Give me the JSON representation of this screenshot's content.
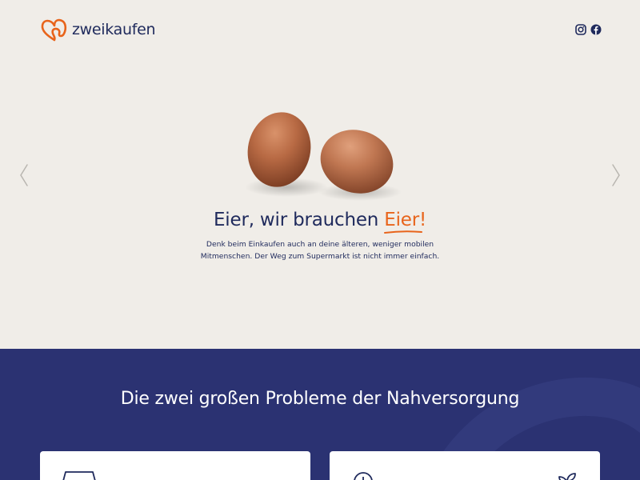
{
  "header": {
    "brand": "zweikaufen",
    "social": [
      "instagram-icon",
      "facebook-icon"
    ]
  },
  "hero": {
    "headline_prefix": "Eier, wir brauchen ",
    "headline_accent": "Eier!",
    "description_line1": "Denk beim Einkaufen auch an deine älteren, weniger mobilen",
    "description_line2": "Mitmenschen. Der Weg zum Supermarkt ist nicht immer einfach."
  },
  "section": {
    "title": "Die zwei großen Probleme der Nahversorgung"
  },
  "colors": {
    "brand": "#e8641b",
    "navy": "#1f2a5c",
    "section_bg": "#2b3272",
    "hero_bg": "#f0ede8"
  }
}
